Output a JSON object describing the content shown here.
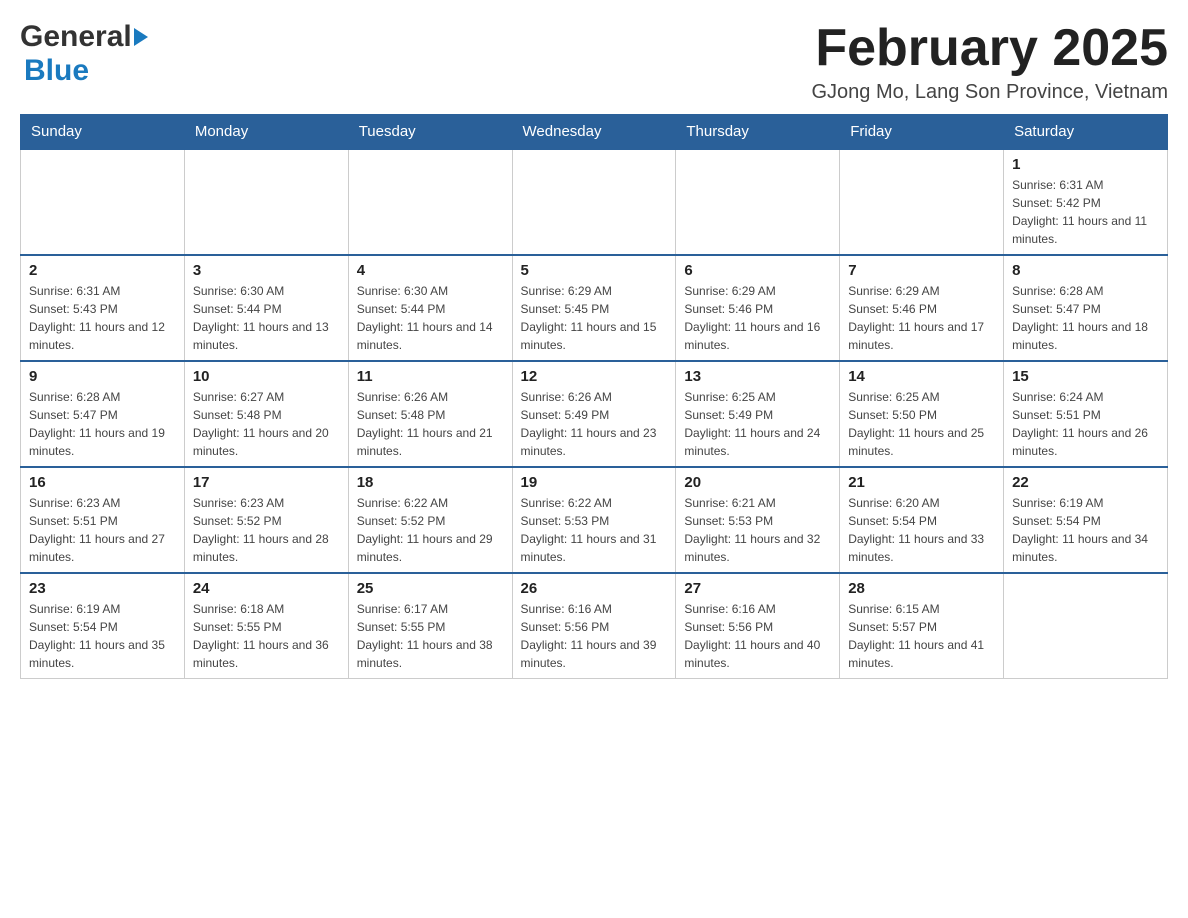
{
  "header": {
    "logo_general": "General",
    "logo_blue": "Blue",
    "title": "February 2025",
    "location": "GJong Mo, Lang Son Province, Vietnam"
  },
  "weekdays": [
    "Sunday",
    "Monday",
    "Tuesday",
    "Wednesday",
    "Thursday",
    "Friday",
    "Saturday"
  ],
  "weeks": [
    {
      "days": [
        {
          "number": "",
          "info": ""
        },
        {
          "number": "",
          "info": ""
        },
        {
          "number": "",
          "info": ""
        },
        {
          "number": "",
          "info": ""
        },
        {
          "number": "",
          "info": ""
        },
        {
          "number": "",
          "info": ""
        },
        {
          "number": "1",
          "info": "Sunrise: 6:31 AM\nSunset: 5:42 PM\nDaylight: 11 hours and 11 minutes."
        }
      ]
    },
    {
      "days": [
        {
          "number": "2",
          "info": "Sunrise: 6:31 AM\nSunset: 5:43 PM\nDaylight: 11 hours and 12 minutes."
        },
        {
          "number": "3",
          "info": "Sunrise: 6:30 AM\nSunset: 5:44 PM\nDaylight: 11 hours and 13 minutes."
        },
        {
          "number": "4",
          "info": "Sunrise: 6:30 AM\nSunset: 5:44 PM\nDaylight: 11 hours and 14 minutes."
        },
        {
          "number": "5",
          "info": "Sunrise: 6:29 AM\nSunset: 5:45 PM\nDaylight: 11 hours and 15 minutes."
        },
        {
          "number": "6",
          "info": "Sunrise: 6:29 AM\nSunset: 5:46 PM\nDaylight: 11 hours and 16 minutes."
        },
        {
          "number": "7",
          "info": "Sunrise: 6:29 AM\nSunset: 5:46 PM\nDaylight: 11 hours and 17 minutes."
        },
        {
          "number": "8",
          "info": "Sunrise: 6:28 AM\nSunset: 5:47 PM\nDaylight: 11 hours and 18 minutes."
        }
      ]
    },
    {
      "days": [
        {
          "number": "9",
          "info": "Sunrise: 6:28 AM\nSunset: 5:47 PM\nDaylight: 11 hours and 19 minutes."
        },
        {
          "number": "10",
          "info": "Sunrise: 6:27 AM\nSunset: 5:48 PM\nDaylight: 11 hours and 20 minutes."
        },
        {
          "number": "11",
          "info": "Sunrise: 6:26 AM\nSunset: 5:48 PM\nDaylight: 11 hours and 21 minutes."
        },
        {
          "number": "12",
          "info": "Sunrise: 6:26 AM\nSunset: 5:49 PM\nDaylight: 11 hours and 23 minutes."
        },
        {
          "number": "13",
          "info": "Sunrise: 6:25 AM\nSunset: 5:49 PM\nDaylight: 11 hours and 24 minutes."
        },
        {
          "number": "14",
          "info": "Sunrise: 6:25 AM\nSunset: 5:50 PM\nDaylight: 11 hours and 25 minutes."
        },
        {
          "number": "15",
          "info": "Sunrise: 6:24 AM\nSunset: 5:51 PM\nDaylight: 11 hours and 26 minutes."
        }
      ]
    },
    {
      "days": [
        {
          "number": "16",
          "info": "Sunrise: 6:23 AM\nSunset: 5:51 PM\nDaylight: 11 hours and 27 minutes."
        },
        {
          "number": "17",
          "info": "Sunrise: 6:23 AM\nSunset: 5:52 PM\nDaylight: 11 hours and 28 minutes."
        },
        {
          "number": "18",
          "info": "Sunrise: 6:22 AM\nSunset: 5:52 PM\nDaylight: 11 hours and 29 minutes."
        },
        {
          "number": "19",
          "info": "Sunrise: 6:22 AM\nSunset: 5:53 PM\nDaylight: 11 hours and 31 minutes."
        },
        {
          "number": "20",
          "info": "Sunrise: 6:21 AM\nSunset: 5:53 PM\nDaylight: 11 hours and 32 minutes."
        },
        {
          "number": "21",
          "info": "Sunrise: 6:20 AM\nSunset: 5:54 PM\nDaylight: 11 hours and 33 minutes."
        },
        {
          "number": "22",
          "info": "Sunrise: 6:19 AM\nSunset: 5:54 PM\nDaylight: 11 hours and 34 minutes."
        }
      ]
    },
    {
      "days": [
        {
          "number": "23",
          "info": "Sunrise: 6:19 AM\nSunset: 5:54 PM\nDaylight: 11 hours and 35 minutes."
        },
        {
          "number": "24",
          "info": "Sunrise: 6:18 AM\nSunset: 5:55 PM\nDaylight: 11 hours and 36 minutes."
        },
        {
          "number": "25",
          "info": "Sunrise: 6:17 AM\nSunset: 5:55 PM\nDaylight: 11 hours and 38 minutes."
        },
        {
          "number": "26",
          "info": "Sunrise: 6:16 AM\nSunset: 5:56 PM\nDaylight: 11 hours and 39 minutes."
        },
        {
          "number": "27",
          "info": "Sunrise: 6:16 AM\nSunset: 5:56 PM\nDaylight: 11 hours and 40 minutes."
        },
        {
          "number": "28",
          "info": "Sunrise: 6:15 AM\nSunset: 5:57 PM\nDaylight: 11 hours and 41 minutes."
        },
        {
          "number": "",
          "info": ""
        }
      ]
    }
  ]
}
